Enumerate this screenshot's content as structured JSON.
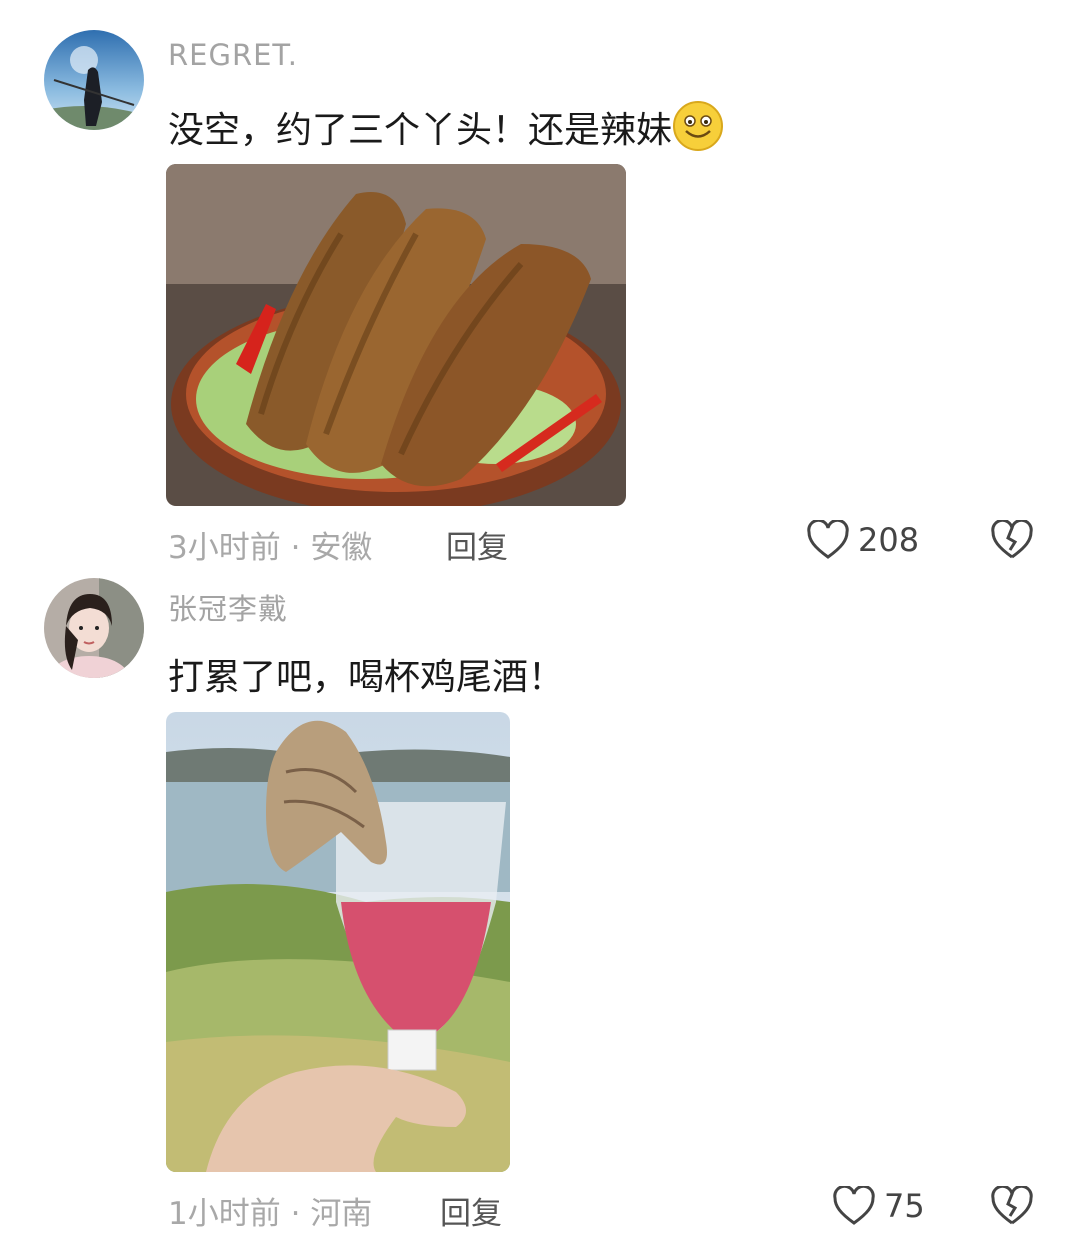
{
  "comments": [
    {
      "username": "REGRET.",
      "text": "没空，约了三个丫头！还是辣妹",
      "emoji": "grinning-face-emoji",
      "time": "3小时前",
      "location": "安徽",
      "reply_label": "回复",
      "like_count": "208"
    },
    {
      "username": "张冠李戴",
      "text": "打累了吧，喝杯鸡尾酒！",
      "time": "1小时前",
      "location": "河南",
      "reply_label": "回复",
      "like_count": "75"
    }
  ],
  "meta_separator": "·",
  "icons": {
    "like": "heart-icon",
    "dislike": "broken-heart-icon"
  }
}
